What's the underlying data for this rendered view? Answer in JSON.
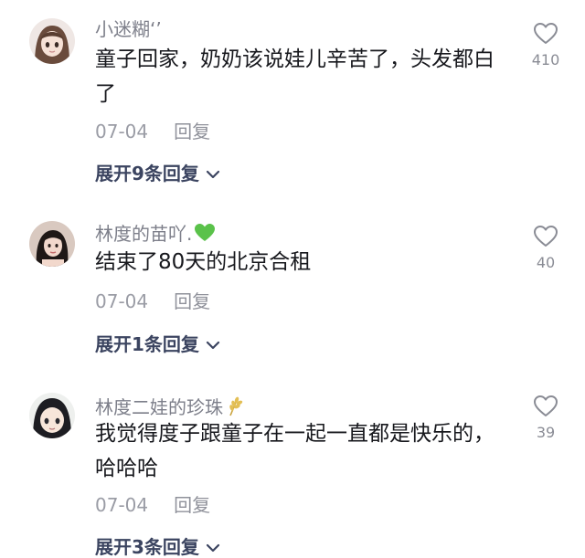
{
  "comments": [
    {
      "username": "小迷糊‘’",
      "text": "童子回家，奶奶该说娃儿辛苦了，头发都白了",
      "date": "07-04",
      "reply_label": "回复",
      "expand_label": "展开9条回复",
      "likes": "410"
    },
    {
      "username": "林度的苗吖.",
      "username_emoji": "green-heart-icon",
      "text": "结束了80天的北京合租",
      "date": "07-04",
      "reply_label": "回复",
      "expand_label": "展开1条回复",
      "likes": "40"
    },
    {
      "username": "林度二娃的珍珠",
      "username_emoji": "wheat-icon",
      "text": "我觉得度子跟童子在一起一直都是快乐的，哈哈哈",
      "date": "07-04",
      "reply_label": "回复",
      "expand_label": "展开3条回复",
      "likes": "39"
    }
  ],
  "colors": {
    "username": "#7d7f8a",
    "body_text": "#17181d",
    "meta": "#9a9ca5",
    "expand": "#3b4460",
    "heart_emoji": "#5ac24a"
  }
}
